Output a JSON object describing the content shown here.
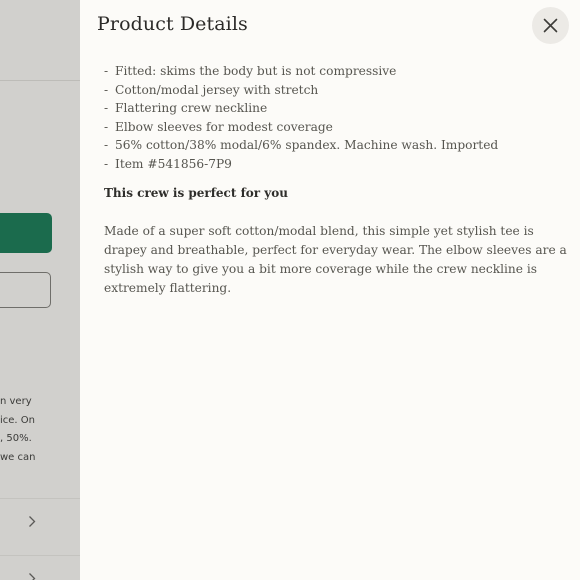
{
  "background": {
    "text_lines": [
      "n very",
      "ice. On",
      ", 50%.",
      "we can"
    ],
    "chevron_icon": "chevron-right-icon"
  },
  "drawer": {
    "title": "Product Details",
    "close_icon": "close-icon",
    "features": [
      "Fitted: skims the body but is not compressive",
      "Cotton/modal jersey with stretch",
      "Flattering crew neckline",
      "Elbow sleeves for modest coverage",
      "56% cotton/38% modal/6% spandex. Machine wash. Imported",
      "Item #541856-7P9"
    ],
    "callout": "This crew is perfect for you",
    "description": "Made of a super soft cotton/modal blend, this simple yet stylish tee is drapey and breathable, perfect for everyday wear. The elbow sleeves are a stylish way to give you a bit more coverage while the crew neckline is extremely flattering."
  },
  "colors": {
    "overlay": "#d1d0cd",
    "panel": "#fcfbf8",
    "accent_green": "#1b6b4d"
  }
}
